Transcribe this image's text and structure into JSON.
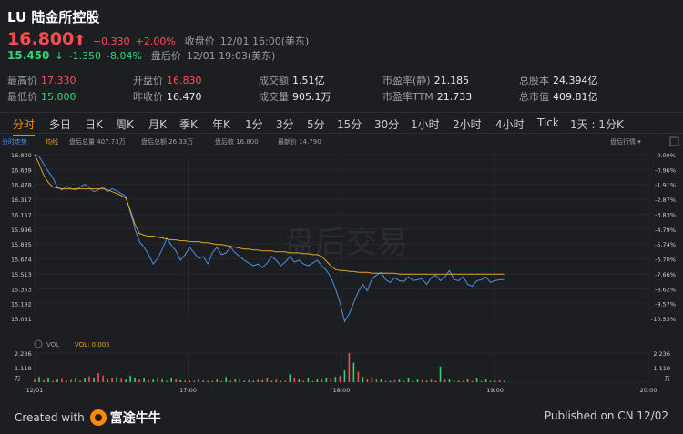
{
  "header": {
    "title": "LU 陆金所控股",
    "close_price": "16.800",
    "change": "+0.330",
    "change_pct": "+2.00%",
    "close_label": "收盘价",
    "close_time": "12/01 16:00(美东)",
    "after_price": "15.450",
    "after_arrow": "↓",
    "after_change": "-1.350",
    "after_change_pct": "-8.04%",
    "after_label": "盘后价",
    "after_time": "12/01 19:03(美东)"
  },
  "stats": [
    {
      "label": "最高价",
      "value": "17.330",
      "color": "#ff4d4f"
    },
    {
      "label": "开盘价",
      "value": "16.830",
      "color": "#ff4d4f"
    },
    {
      "label": "成交额",
      "value": "1.51亿",
      "color": "#e8e9ec"
    },
    {
      "label": "市盈率(静)",
      "value": "21.185",
      "color": "#e8e9ec"
    },
    {
      "label": "总股本",
      "value": "24.394亿",
      "color": "#e8e9ec"
    },
    {
      "label": "最低价",
      "value": "15.800",
      "color": "#2ed573"
    },
    {
      "label": "昨收价",
      "value": "16.470",
      "color": "#e8e9ec"
    },
    {
      "label": "成交量",
      "value": "905.1万",
      "color": "#e8e9ec"
    },
    {
      "label": "市盈率TTM",
      "value": "21.733",
      "color": "#e8e9ec"
    },
    {
      "label": "总市值",
      "value": "409.81亿",
      "color": "#e8e9ec"
    }
  ],
  "tabs": [
    "分时",
    "多日",
    "日K",
    "周K",
    "月K",
    "季K",
    "年K",
    "1分",
    "3分",
    "5分",
    "15分",
    "30分",
    "1小时",
    "2小时",
    "4小时",
    "Tick",
    "1天 : 1分K"
  ],
  "active_tab": "分时",
  "legend": {
    "left_label": "分时走势",
    "avg_label": "均线",
    "vol_text": "盘后总量 407.73万",
    "amt_text": "盘后总额 26.33万",
    "close_text": "盘后收 16.800",
    "last_text": "最新价 14.790",
    "right_link": "盘后行情 ▾"
  },
  "watermark": "盘后交易",
  "volume_legend": {
    "name": "VOL",
    "value": "VOL: 0.005"
  },
  "colors": {
    "price_line": "#4a90e2",
    "avg_line": "#e0a526",
    "up": "#ff4d4f",
    "down": "#2ed573",
    "accent": "#ff8a00"
  },
  "footer": {
    "created_with": "Created with",
    "brand": "富途牛牛",
    "published": "Published on CN 12/02"
  },
  "chart_data": {
    "type": "line",
    "x_labels": [
      "12/01",
      "17:00",
      "18:00",
      "19:00",
      "20:00"
    ],
    "y_ticks": [
      "16.800",
      "16.639",
      "16.478",
      "16.317",
      "16.157",
      "15.996",
      "15.835",
      "15.674",
      "15.513",
      "15.353",
      "15.192",
      "15.031"
    ],
    "pct_ticks": [
      "0.00%",
      "-0.96%",
      "-1.91%",
      "-2.87%",
      "-3.83%",
      "-4.79%",
      "-5.74%",
      "-6.70%",
      "-7.66%",
      "-8.62%",
      "-9.57%",
      "-10.53%"
    ],
    "ylim": [
      15.031,
      16.8
    ],
    "vol_ticks": [
      "2.236",
      "1.118",
      "万"
    ],
    "vol_max": 2.236,
    "series": [
      {
        "name": "分时走势",
        "values": [
          16.8,
          16.78,
          16.7,
          16.62,
          16.55,
          16.45,
          16.42,
          16.46,
          16.43,
          16.42,
          16.45,
          16.48,
          16.44,
          16.4,
          16.42,
          16.45,
          16.4,
          16.43,
          16.41,
          16.38,
          16.35,
          16.18,
          16.0,
          15.86,
          15.8,
          15.72,
          15.62,
          15.68,
          15.78,
          15.9,
          15.82,
          15.76,
          15.66,
          15.72,
          15.8,
          15.74,
          15.68,
          15.7,
          15.62,
          15.74,
          15.8,
          15.72,
          15.74,
          15.8,
          15.74,
          15.7,
          15.66,
          15.63,
          15.6,
          15.62,
          15.58,
          15.63,
          15.7,
          15.66,
          15.6,
          15.64,
          15.7,
          15.64,
          15.66,
          15.62,
          15.6,
          15.63,
          15.66,
          15.6,
          15.55,
          15.48,
          15.35,
          15.2,
          15.0,
          15.08,
          15.2,
          15.32,
          15.4,
          15.33,
          15.46,
          15.5,
          15.53,
          15.45,
          15.42,
          15.47,
          15.44,
          15.43,
          15.48,
          15.44,
          15.45,
          15.46,
          15.4,
          15.47,
          15.5,
          15.44,
          15.48,
          15.55,
          15.45,
          15.44,
          15.48,
          15.4,
          15.38,
          15.44,
          15.45,
          15.48,
          15.42,
          15.44,
          15.45,
          15.45
        ]
      },
      {
        "name": "均线",
        "values": [
          16.8,
          16.7,
          16.58,
          16.5,
          16.45,
          16.44,
          16.43,
          16.43,
          16.43,
          16.43,
          16.43,
          16.43,
          16.43,
          16.43,
          16.43,
          16.43,
          16.42,
          16.4,
          16.38,
          16.36,
          16.33,
          16.2,
          16.05,
          15.95,
          15.93,
          15.92,
          15.92,
          15.91,
          15.9,
          15.89,
          15.88,
          15.88,
          15.87,
          15.87,
          15.86,
          15.86,
          15.86,
          15.85,
          15.85,
          15.84,
          15.83,
          15.83,
          15.82,
          15.81,
          15.8,
          15.79,
          15.78,
          15.78,
          15.77,
          15.77,
          15.76,
          15.76,
          15.76,
          15.75,
          15.75,
          15.75,
          15.74,
          15.74,
          15.74,
          15.73,
          15.73,
          15.72,
          15.72,
          15.7,
          15.65,
          15.6,
          15.56,
          15.55,
          15.55,
          15.54,
          15.54,
          15.53,
          15.53,
          15.53,
          15.52,
          15.52,
          15.52,
          15.52,
          15.52,
          15.52,
          15.51,
          15.51,
          15.51,
          15.51,
          15.51,
          15.51,
          15.51,
          15.51,
          15.51,
          15.51,
          15.51,
          15.51,
          15.51,
          15.51,
          15.51,
          15.51,
          15.51,
          15.51,
          15.51,
          15.51,
          15.51,
          15.51,
          15.51,
          15.51
        ]
      }
    ],
    "volume": [
      0.2,
      0.4,
      0.15,
      0.3,
      0.1,
      0.2,
      0.25,
      0.1,
      0.18,
      0.3,
      0.12,
      0.28,
      0.45,
      0.3,
      0.7,
      0.5,
      0.2,
      0.3,
      0.4,
      0.25,
      0.2,
      0.5,
      0.3,
      0.2,
      0.35,
      0.15,
      0.2,
      0.3,
      0.2,
      0.1,
      0.3,
      0.2,
      0.15,
      0.12,
      0.1,
      0.1,
      0.2,
      0.15,
      0.1,
      0.1,
      0.2,
      0.1,
      0.4,
      0.1,
      0.2,
      0.25,
      0.1,
      0.15,
      0.1,
      0.2,
      0.15,
      0.3,
      0.1,
      0.2,
      0.1,
      0.1,
      0.6,
      0.3,
      0.2,
      0.1,
      0.35,
      0.1,
      0.2,
      0.2,
      0.3,
      0.25,
      0.4,
      0.5,
      0.9,
      2.236,
      1.5,
      0.8,
      0.4,
      0.2,
      0.3,
      0.2,
      0.2,
      0.1,
      0.1,
      0.15,
      0.2,
      0.1,
      0.3,
      0.1,
      0.2,
      0.15,
      0.1,
      0.2,
      0.1,
      1.2,
      0.2,
      0.2,
      0.1,
      0.1,
      0.1,
      0.2,
      0.1,
      0.3,
      0.1,
      0.2,
      0.1,
      0.1,
      0.15,
      0.1
    ],
    "volume_dir": [
      "up",
      "down",
      "up",
      "down",
      "up",
      "down",
      "up",
      "down",
      "up",
      "down",
      "up",
      "down",
      "up",
      "down",
      "up",
      "up",
      "down",
      "up",
      "down",
      "up",
      "down",
      "down",
      "down",
      "up",
      "down",
      "up",
      "down",
      "up",
      "down",
      "up",
      "down",
      "up",
      "down",
      "up",
      "down",
      "up",
      "down",
      "up",
      "down",
      "up",
      "down",
      "up",
      "down",
      "up",
      "down",
      "up",
      "down",
      "up",
      "down",
      "up",
      "down",
      "up",
      "down",
      "up",
      "down",
      "up",
      "down",
      "up",
      "down",
      "up",
      "down",
      "up",
      "down",
      "up",
      "down",
      "up",
      "down",
      "up",
      "down",
      "up",
      "down",
      "up",
      "down",
      "up",
      "down",
      "up",
      "down",
      "up",
      "down",
      "up",
      "down",
      "up",
      "down",
      "up",
      "down",
      "up",
      "down",
      "up",
      "down",
      "down",
      "up",
      "down",
      "up",
      "down",
      "up",
      "down",
      "up",
      "down",
      "up",
      "down",
      "up",
      "down",
      "up",
      "down"
    ]
  }
}
